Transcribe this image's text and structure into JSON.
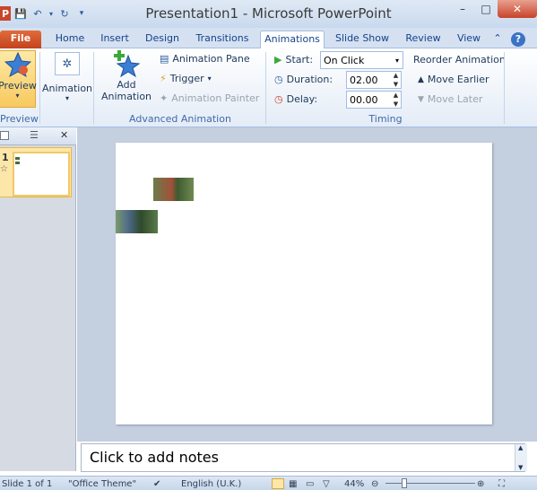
{
  "window": {
    "title": "Presentation1 - Microsoft PowerPoint"
  },
  "tabs": [
    "File",
    "Home",
    "Insert",
    "Design",
    "Transitions",
    "Animations",
    "Slide Show",
    "Review",
    "View"
  ],
  "active_tab": "Animations",
  "ribbon": {
    "preview": {
      "button": "Preview",
      "group": "Preview"
    },
    "animation": {
      "button": "Animation"
    },
    "advanced": {
      "add_animation": "Add Animation",
      "animation_pane": "Animation Pane",
      "trigger": "Trigger",
      "animation_painter": "Animation Painter",
      "group": "Advanced Animation"
    },
    "timing": {
      "start_label": "Start:",
      "start_value": "On Click",
      "duration_label": "Duration:",
      "duration_value": "02.00",
      "delay_label": "Delay:",
      "delay_value": "00.00",
      "reorder": "Reorder Animation",
      "move_earlier": "Move Earlier",
      "move_later": "Move Later",
      "group": "Timing"
    }
  },
  "slides_pane": {
    "slide_number": "1"
  },
  "notes": {
    "placeholder": "Click to add notes"
  },
  "status": {
    "slide": "Slide 1 of 1",
    "theme": "\"Office Theme\"",
    "language": "English (U.K.)",
    "zoom": "44%"
  },
  "colors": {
    "accent": "#15428b",
    "file_tab": "#d04a24",
    "close": "#c7432a"
  }
}
